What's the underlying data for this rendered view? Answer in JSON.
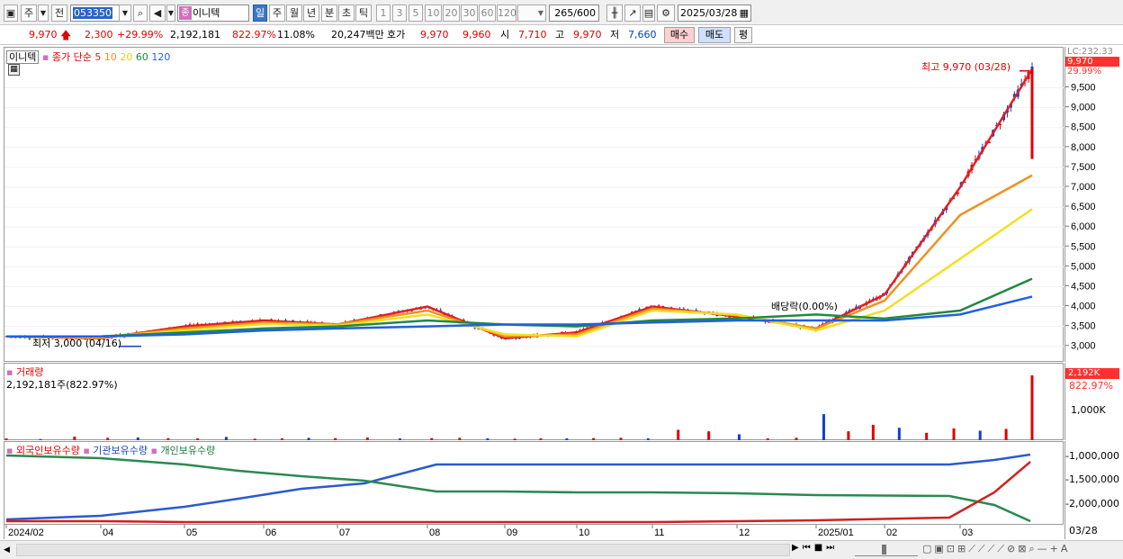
{
  "toolbar": {
    "mode_label": "주",
    "prev_label": "전",
    "code": "053350",
    "name_tag": "종",
    "name": "이니텍",
    "period_buttons": [
      "일",
      "주",
      "월",
      "년",
      "분",
      "초",
      "틱"
    ],
    "interval_buttons": [
      "1",
      "3",
      "5",
      "10",
      "20",
      "30",
      "60",
      "120"
    ],
    "count": "265",
    "count_total": "/600",
    "date": "2025/03/28"
  },
  "quote": {
    "price": "9,970",
    "change": "2,300",
    "change_pct": "+29.99%",
    "volume": "2,192,181",
    "volume_ratio": "822.97%",
    "turnover": "11.08%",
    "amount": "20,247백만",
    "bid_label": "호가",
    "ask": "9,970",
    "bid": "9,960",
    "open_label": "시",
    "open": "7,710",
    "high_label": "고",
    "high": "9,970",
    "low_label": "저",
    "low": "7,660",
    "buy_label": "매수",
    "sell_label": "매도",
    "eval_label": "평"
  },
  "legend": {
    "stock": "이니텍",
    "series_label": "종가 단순",
    "ma": [
      "5",
      "10",
      "20",
      "60",
      "120"
    ]
  },
  "annotations": {
    "high": "최고 9,970 (03/28)",
    "low": "최저 3,000 (04/16)",
    "dividend": "배당락(0.00%)",
    "lc": "LC:232.33",
    "price_tag": "9,970",
    "pct_tag": "29.99%"
  },
  "volume_panel": {
    "title": "거래량",
    "value": "2,192,181주(822.97%)",
    "tag": "2,192K",
    "pct": "822.97%",
    "tick": "1,000K"
  },
  "holding_panel": {
    "foreign": "외국인보유수량",
    "institution": "기관보유수량",
    "individual": "개인보유수량",
    "ticks": [
      "-1,000,000",
      "-1,500,000",
      "-2,000,000"
    ]
  },
  "xaxis": {
    "labels": [
      "2024/02",
      "04",
      "05",
      "06",
      "07",
      "08",
      "09",
      "10",
      "11",
      "12",
      "2025/01",
      "02",
      "03"
    ],
    "last_date": "03/28"
  },
  "colors": {
    "up": "#e00000",
    "down": "#1040d0",
    "ma5": "#e02020",
    "ma10": "#f09020",
    "ma20": "#f0e020",
    "ma60": "#208a40",
    "ma120": "#2060e0",
    "highlight": "#ff4040"
  },
  "chart_data": {
    "type": "line",
    "title": "",
    "ylim": [
      2700,
      10100
    ],
    "yticks": [
      3000,
      3500,
      4000,
      4500,
      5000,
      5500,
      6000,
      6500,
      7000,
      7500,
      8000,
      8500,
      9000,
      9500
    ],
    "x": [
      "2024/02",
      "04",
      "05",
      "06",
      "07",
      "08",
      "09",
      "10",
      "11",
      "12",
      "2025/01",
      "02",
      "03",
      "03/28"
    ],
    "series": [
      {
        "name": "5",
        "values": [
          3250,
          3200,
          3500,
          3650,
          3550,
          4000,
          3200,
          3350,
          4000,
          3750,
          3450,
          4300,
          7000,
          9970
        ]
      },
      {
        "name": "10",
        "values": [
          3250,
          3220,
          3450,
          3600,
          3550,
          3900,
          3250,
          3300,
          3950,
          3780,
          3450,
          4150,
          6300,
          7300
        ]
      },
      {
        "name": "20",
        "values": [
          3250,
          3230,
          3400,
          3560,
          3520,
          3800,
          3300,
          3250,
          3900,
          3800,
          3400,
          3900,
          5200,
          6450
        ]
      },
      {
        "name": "60",
        "values": [
          3250,
          3250,
          3350,
          3450,
          3500,
          3650,
          3550,
          3500,
          3650,
          3700,
          3800,
          3700,
          3900,
          4700
        ]
      },
      {
        "name": "120",
        "values": [
          3250,
          3250,
          3300,
          3400,
          3450,
          3500,
          3550,
          3550,
          3600,
          3650,
          3650,
          3650,
          3800,
          4250
        ]
      }
    ],
    "volume": {
      "max_label": "2,192K",
      "values": [
        60,
        40,
        120,
        80,
        90,
        70,
        60,
        110,
        50,
        60,
        80,
        70,
        90,
        60,
        70,
        80,
        60,
        50,
        60,
        60,
        70,
        80,
        60,
        350,
        300,
        200,
        60,
        80,
        880,
        300,
        520,
        420,
        250,
        400,
        320,
        380,
        2192
      ]
    }
  }
}
